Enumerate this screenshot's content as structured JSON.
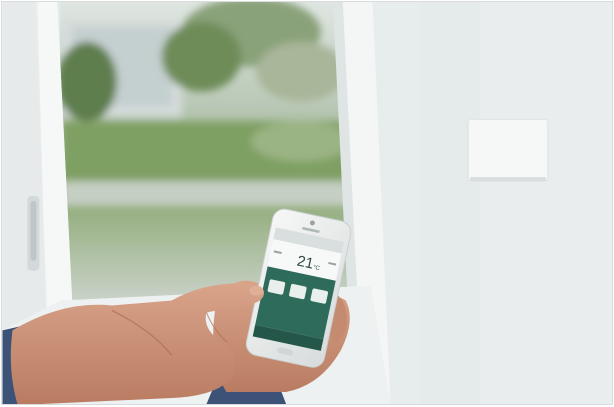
{
  "photo": {
    "subject": "hand-holding-smartphone-thermostat-app",
    "colors": {
      "wall": "#e9eded",
      "frame": "#f3f5f5",
      "lawn": "#7fa064",
      "foliage": "#5f7e4e",
      "skin": "#c98f72",
      "sleeve": "#3c5276",
      "app_accent": "#2f6b5a"
    }
  },
  "phone_app": {
    "temperature": "21",
    "temperature_unit": "°C",
    "mode_icons": [
      "sun-icon",
      "moon-icon",
      "snowflake-icon"
    ],
    "colors": {
      "header": "#d9dede",
      "panel": "#2f6b5a",
      "screen_bg": "#f2f4f4"
    }
  }
}
